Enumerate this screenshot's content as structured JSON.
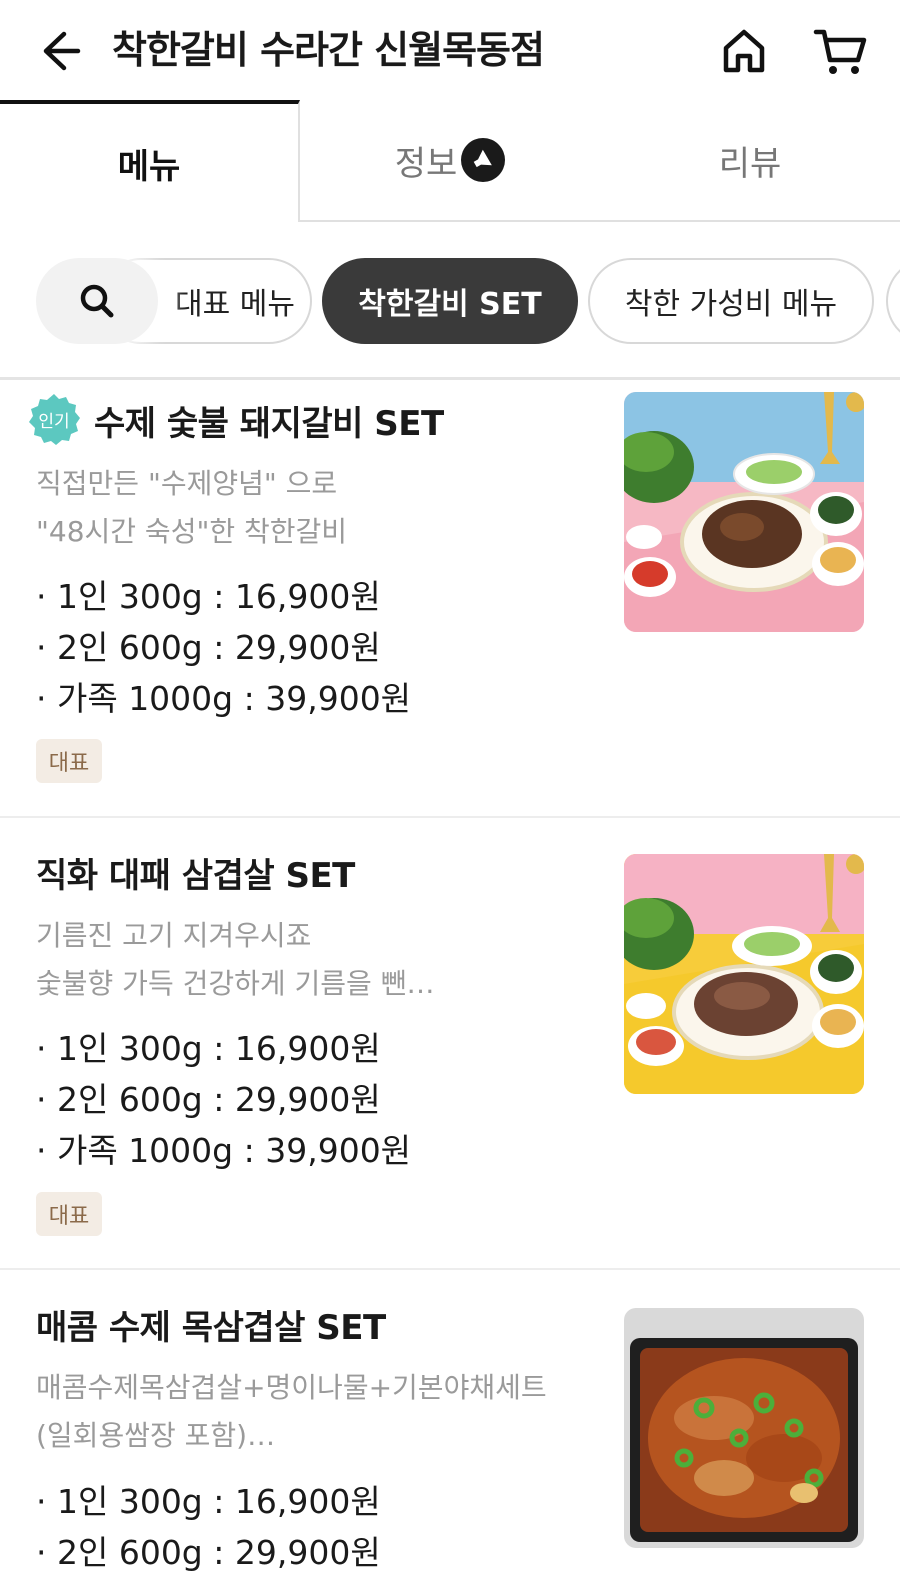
{
  "header": {
    "title": "착한갈비 수라간 신월목동점"
  },
  "tabs": [
    {
      "label": "메뉴"
    },
    {
      "label": "정보"
    },
    {
      "label": "리뷰"
    }
  ],
  "chips": [
    {
      "label": "대표 메뉴",
      "selected": false
    },
    {
      "label": "착한갈비 SET",
      "selected": true
    },
    {
      "label": "착한 가성비 메뉴",
      "selected": false
    },
    {
      "label": "",
      "selected": false
    }
  ],
  "menu_items": [
    {
      "badge": "인기",
      "title": "수제 숯불 돼지갈비 SET",
      "desc": [
        "직접만든 \"수제양념\" 으로",
        "\"48시간 숙성\"한 착한갈비"
      ],
      "prices": [
        "· 1인 300g : 16,900원",
        "· 2인 600g : 29,900원",
        "· 가족 1000g : 39,900원"
      ],
      "tag": "대표"
    },
    {
      "title": "직화 대패 삼겹살 SET",
      "desc": [
        "기름진 고기 지겨우시죠",
        "숯불향 가득 건강하게 기름을 뺀…"
      ],
      "prices": [
        "· 1인 300g : 16,900원",
        "· 2인 600g : 29,900원",
        "· 가족 1000g : 39,900원"
      ],
      "tag": "대표"
    },
    {
      "title": "매콤 수제 목삼겹살 SET",
      "desc": [
        "매콤수제목삼겹살+명이나물+기본야채세트",
        "(일회용쌈장 포함)…"
      ],
      "prices": [
        "· 1인 300g : 16,900원",
        "· 2인 600g : 29,900원"
      ]
    }
  ],
  "colors": {
    "accent_dark": "#3a3a3a",
    "badge_teal": "#5cc8c0",
    "tag_bg": "#f3ece4",
    "tag_text": "#8b6a4a"
  }
}
